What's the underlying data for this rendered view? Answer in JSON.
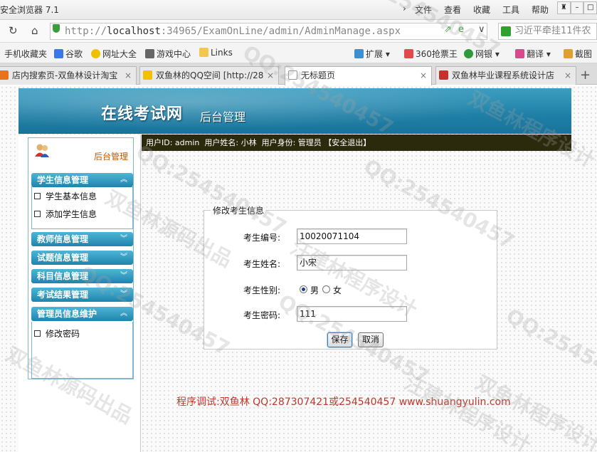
{
  "browser": {
    "title": "安全浏览器 7.1",
    "menus": [
      "文件",
      "查看",
      "收藏",
      "工具",
      "帮助"
    ],
    "url_prefix": "http://",
    "url_host": "localhost",
    "url_rest": ":34965/ExamOnLine/admin/AdminManage.aspx",
    "search_text": "习近平牵挂11件农",
    "favorites": [
      "手机收藏夹",
      "谷歌",
      "网址大全",
      "游戏中心",
      "Links",
      "扩展",
      "360抢票王",
      "网银",
      "翻译",
      "截图"
    ],
    "tabs": [
      {
        "label": "店内搜索页-双鱼林设计淘宝"
      },
      {
        "label": "双鱼林的QQ空间 [http://28"
      },
      {
        "label": "无标题页"
      },
      {
        "label": "双鱼林毕业课程系统设计店"
      }
    ]
  },
  "header": {
    "title": "在线考试网",
    "subtitle": "后台管理"
  },
  "userbar": {
    "text": "用户ID: admin  用户姓名: 小林  用户身份: 管理员 【安全退出】"
  },
  "sidebar": {
    "heading": "后台管理",
    "categories": [
      {
        "label": "学生信息管理",
        "items": [
          "学生基本信息",
          "添加学生信息"
        ]
      },
      {
        "label": "教师信息管理"
      },
      {
        "label": "试题信息管理"
      },
      {
        "label": "科目信息管理"
      },
      {
        "label": "考试结果管理"
      },
      {
        "label": "管理员信息维护",
        "items": [
          "修改密码"
        ]
      }
    ]
  },
  "form": {
    "legend": "修改考生信息",
    "fields": {
      "id_label": "考生编号:",
      "id_value": "10020071104",
      "name_label": "考生姓名:",
      "name_value": "小宋",
      "gender_label": "考生性别:",
      "gender_male": "男",
      "gender_female": "女",
      "gender_selected": "男",
      "password_label": "考生密码:",
      "password_value": "111"
    },
    "save_label": "保存",
    "cancel_label": "取消"
  },
  "footer": {
    "text": "程序调试:双鱼林 QQ:287307421或254540457 www.shuangyulin.com"
  },
  "watermarks": [
    "QQ:254540457",
    "双鱼林源码出品",
    "汪建林程序设计",
    "双鱼林程序设计"
  ]
}
